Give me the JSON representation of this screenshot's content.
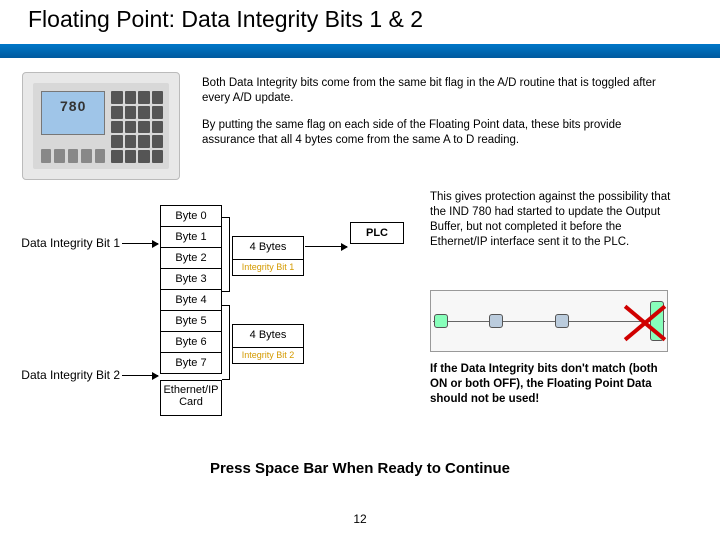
{
  "title": "Floating Point: Data Integrity Bits 1 & 2",
  "device": {
    "display": "780"
  },
  "intro": {
    "p1": "Both Data Integrity bits come from the same bit flag in the A/D routine that is toggled after every A/D update.",
    "p2": "By putting the same flag on each side of the Floating Point data, these bits provide assurance that all 4 bytes come from the same A to D reading."
  },
  "bytes": [
    "Byte 0",
    "Byte 1",
    "Byte 2",
    "Byte 3",
    "Byte 4",
    "Byte 5",
    "Byte 6",
    "Byte 7"
  ],
  "eth_card": "Ethernet/IP Card",
  "dib_labels": {
    "b1": "Data Integrity Bit 1",
    "b2": "Data Integrity Bit 2"
  },
  "group": {
    "bytes_label": "4 Bytes",
    "int1": "Integrity Bit 1",
    "int2": "Integrity Bit 2"
  },
  "plc": "PLC",
  "side": {
    "p1": "This gives protection against the possibility that the IND 780 had started to update the Output Buffer, but not completed it before the Ethernet/IP interface sent it to the PLC.",
    "p2a": "If the Data Integrity bits don't match (both ON or both OFF), the Floating Point Data should not be used!"
  },
  "footer": "Press Space Bar When Ready to Continue",
  "page": "12"
}
